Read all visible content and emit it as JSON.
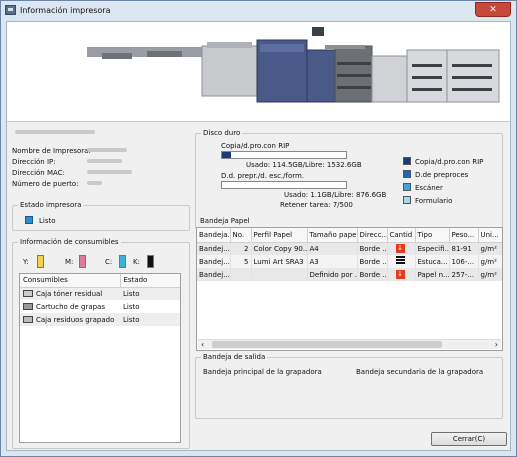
{
  "window": {
    "title": "Información impresora",
    "close_glyph": "✕"
  },
  "printer_info": {
    "rows": [
      {
        "label": "Nombre de Impresora:"
      },
      {
        "label": "Dirección IP:"
      },
      {
        "label": "Dirección MAC:"
      },
      {
        "label": "Número de puerto:"
      }
    ]
  },
  "status": {
    "title": "Estado impresora",
    "value": "Listo",
    "color": "#2e8fd0"
  },
  "consumables": {
    "title": "Información de consumibles",
    "toners": [
      {
        "label": "Y:",
        "color": "#f2d24a"
      },
      {
        "label": "M:",
        "color": "#e07a9a"
      },
      {
        "label": "C:",
        "color": "#3bb0d8"
      },
      {
        "label": "K:",
        "color": "#111111"
      }
    ],
    "columns": [
      "Consumibles",
      "Estado"
    ],
    "rows": [
      {
        "name": "Caja tóner residual",
        "status": "Listo",
        "icon": "toner-waste-icon"
      },
      {
        "name": "Cartucho de grapas",
        "status": "Listo",
        "icon": "staple-cartridge-icon"
      },
      {
        "name": "Caja residuos grapado",
        "status": "Listo",
        "icon": "staple-waste-icon"
      }
    ]
  },
  "hdd": {
    "title": "Disco duro",
    "rip_label": "Copia/d.pro.con RIP",
    "rip_usage": "Usado: 114.5GB/Libre: 1532.6GB",
    "rip_fill": 0.07,
    "prepr_label": "D.d. prepr./d. esc./form.",
    "prepr_usage": "Usado: 1.1GB/Libre: 876.6GB",
    "prepr_fill": 0.0,
    "retain": "Retener tarea: 7/500",
    "legend": [
      {
        "label": "Copia/d.pro.con RIP",
        "color": "#1c3a78"
      },
      {
        "label": "D.de preproces",
        "color": "#1e64c8"
      },
      {
        "label": "Escáner",
        "color": "#3aa8e0"
      },
      {
        "label": "Formulario",
        "color": "#a8d6ef"
      }
    ]
  },
  "trays": {
    "title": "Bandeja Papel",
    "columns": [
      "Bandeja...",
      "No.",
      "Perfil Papel",
      "Tamaño papel",
      "Direcc...",
      "Cantid",
      "Tipo",
      "Peso...",
      "Uni..."
    ],
    "rows": [
      {
        "tray": "Bandej...",
        "no": "2",
        "profile": "Color Copy 90...",
        "size": "A4",
        "dir": "Borde ...",
        "qty": "empty",
        "type": "Especifi...",
        "weight": "81-91",
        "unit": "g/m²"
      },
      {
        "tray": "Bandej...",
        "no": "5",
        "profile": "Lumi Art SRA3",
        "size": "A3",
        "dir": "Borde ...",
        "qty": "full",
        "type": "Estuca...",
        "weight": "106-...",
        "unit": "g/m²"
      },
      {
        "tray": "Bandej...",
        "no": "",
        "profile": "",
        "size": "Definido por ...",
        "dir": "Borde ...",
        "qty": "empty",
        "type": "Papel n...",
        "weight": "257-...",
        "unit": "g/m²"
      }
    ]
  },
  "output": {
    "title": "Bandeja de salida",
    "items": [
      "Bandeja principal de la grapadora",
      "Bandeja secundaria de la grapadora"
    ]
  },
  "close_button": {
    "label": "Cerrar(C)"
  }
}
